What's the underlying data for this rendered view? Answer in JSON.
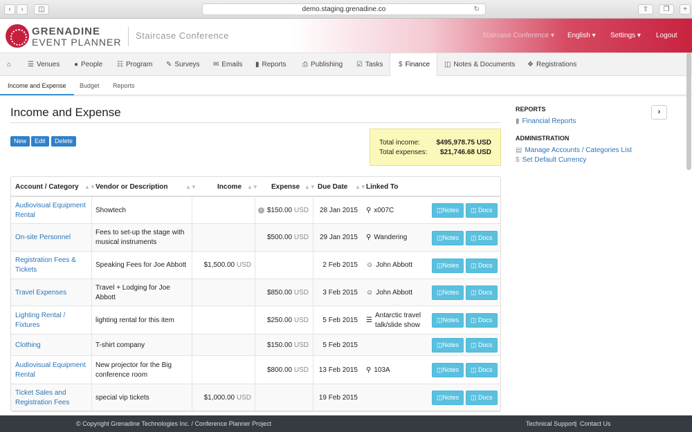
{
  "browser": {
    "url": "demo.staging.grenadine.co"
  },
  "header": {
    "brand_line1": "GRENADINE",
    "brand_line2": "EVENT PLANNER",
    "conference": "Staircase Conference",
    "nav": [
      {
        "label": "Staircase Conference",
        "caret": true
      },
      {
        "label": "English",
        "caret": true
      },
      {
        "label": "Settings",
        "caret": true
      },
      {
        "label": "Logout",
        "caret": false
      }
    ]
  },
  "mainnav": [
    {
      "label": "",
      "icon": "home-icon"
    },
    {
      "label": "Venues",
      "icon": "list-icon"
    },
    {
      "label": "People",
      "icon": "user-icon"
    },
    {
      "label": "Program",
      "icon": "program-icon"
    },
    {
      "label": "Surveys",
      "icon": "pencil-icon"
    },
    {
      "label": "Emails",
      "icon": "envelope-icon"
    },
    {
      "label": "Reports",
      "icon": "bar-chart-icon"
    },
    {
      "label": "Publishing",
      "icon": "print-icon"
    },
    {
      "label": "Tasks",
      "icon": "checkbox-icon"
    },
    {
      "label": "Finance",
      "icon": "dollar-icon",
      "active": true
    },
    {
      "label": "Notes & Documents",
      "icon": "file-icon"
    },
    {
      "label": "Registrations",
      "icon": "tag-icon"
    }
  ],
  "subnav": [
    {
      "label": "Income and Expense",
      "active": true
    },
    {
      "label": "Budget"
    },
    {
      "label": "Reports"
    }
  ],
  "page": {
    "title": "Income and Expense",
    "buttons": {
      "new": "New",
      "edit": "Edit",
      "delete": "Delete"
    },
    "totals": {
      "income_label": "Total income:",
      "income_value": "$495,978.75 USD",
      "expense_label": "Total expenses:",
      "expense_value": "$21,746.68 USD"
    }
  },
  "table": {
    "headers": {
      "category": "Account / Category",
      "vendor": "Vendor or Description",
      "income": "Income",
      "expense": "Expense",
      "due": "Due Date",
      "linked": "Linked To"
    },
    "notes_label": "Notes",
    "docs_label": "Docs",
    "currency": "USD",
    "rows": [
      {
        "category": "Audiovisual Equipment Rental",
        "vendor": "Showtech",
        "income": "",
        "expense": "$150.00",
        "expense_info": true,
        "due": "28 Jan 2015",
        "linked": "x007C",
        "linked_icon": "map-marker-icon"
      },
      {
        "category": "On-site Personnel",
        "vendor": "Fees to set-up the stage with musical instruments",
        "income": "",
        "expense": "$500.00",
        "due": "29 Jan 2015",
        "linked": "Wandering",
        "linked_icon": "map-marker-icon"
      },
      {
        "category": "Registration Fees & Tickets",
        "vendor": "Speaking Fees for Joe Abbott",
        "income": "$1,500.00",
        "expense": "",
        "due": "2 Feb 2015",
        "linked": "John Abbott",
        "linked_icon": "user-icon"
      },
      {
        "category": "Travel Expenses",
        "vendor": "Travel + Lodging for Joe Abbott",
        "income": "",
        "expense": "$850.00",
        "due": "3 Feb 2015",
        "linked": "John Abbott",
        "linked_icon": "user-icon"
      },
      {
        "category": "Lighting Rental / Fixtures",
        "vendor": "lighting rental for this item",
        "income": "",
        "expense": "$250.00",
        "due": "5 Feb 2015",
        "linked": "Antarctic travel talk/slide show",
        "linked_icon": "program-icon"
      },
      {
        "category": "Clothing",
        "vendor": "T-shirt company",
        "income": "",
        "expense": "$150.00",
        "due": "5 Feb 2015",
        "linked": "",
        "linked_icon": ""
      },
      {
        "category": "Audiovisual Equipment Rental",
        "vendor": "New projector for the Big conference room",
        "income": "",
        "expense": "$800.00",
        "due": "13 Feb 2015",
        "linked": "103A",
        "linked_icon": "map-marker-icon"
      },
      {
        "category": "Ticket Sales and Registration Fees",
        "vendor": "special vip tickets",
        "income": "$1,000.00",
        "expense": "",
        "due": "19 Feb 2015",
        "linked": "",
        "linked_icon": ""
      }
    ]
  },
  "sidebar": {
    "reports_heading": "REPORTS",
    "reports_link": "Financial Reports",
    "admin_heading": "ADMINISTRATION",
    "admin_links": [
      "Manage Accounts / Categories List",
      "Set Default Currency"
    ]
  },
  "footer": {
    "copyright": "© Copyright Grenadine Technologies Inc. / Conference Planner Project",
    "support": "Technical Support",
    "contact": "Contact Us"
  }
}
